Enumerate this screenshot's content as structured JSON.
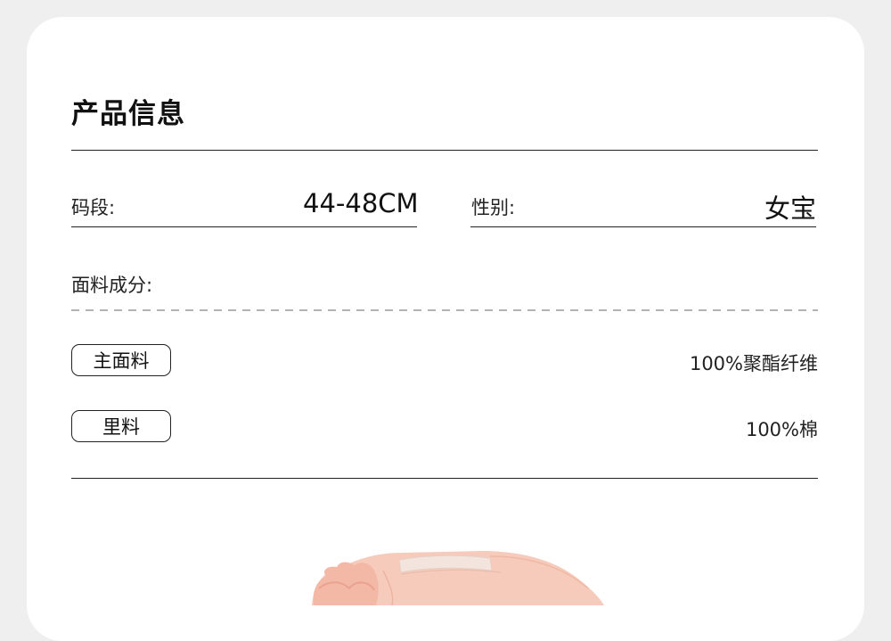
{
  "section_title": "产品信息",
  "size": {
    "label": "码段:",
    "value": "44-48CM"
  },
  "gender": {
    "label": "性别:",
    "value": "女宝"
  },
  "fabric": {
    "label": "面料成分:",
    "rows": [
      {
        "name": "主面料",
        "value": "100%聚酯纤维"
      },
      {
        "name": "里料",
        "value": "100%棉"
      }
    ]
  },
  "product_image": {
    "subject": "pink ruffled baby bonnet",
    "color": "#f4c4b2"
  }
}
